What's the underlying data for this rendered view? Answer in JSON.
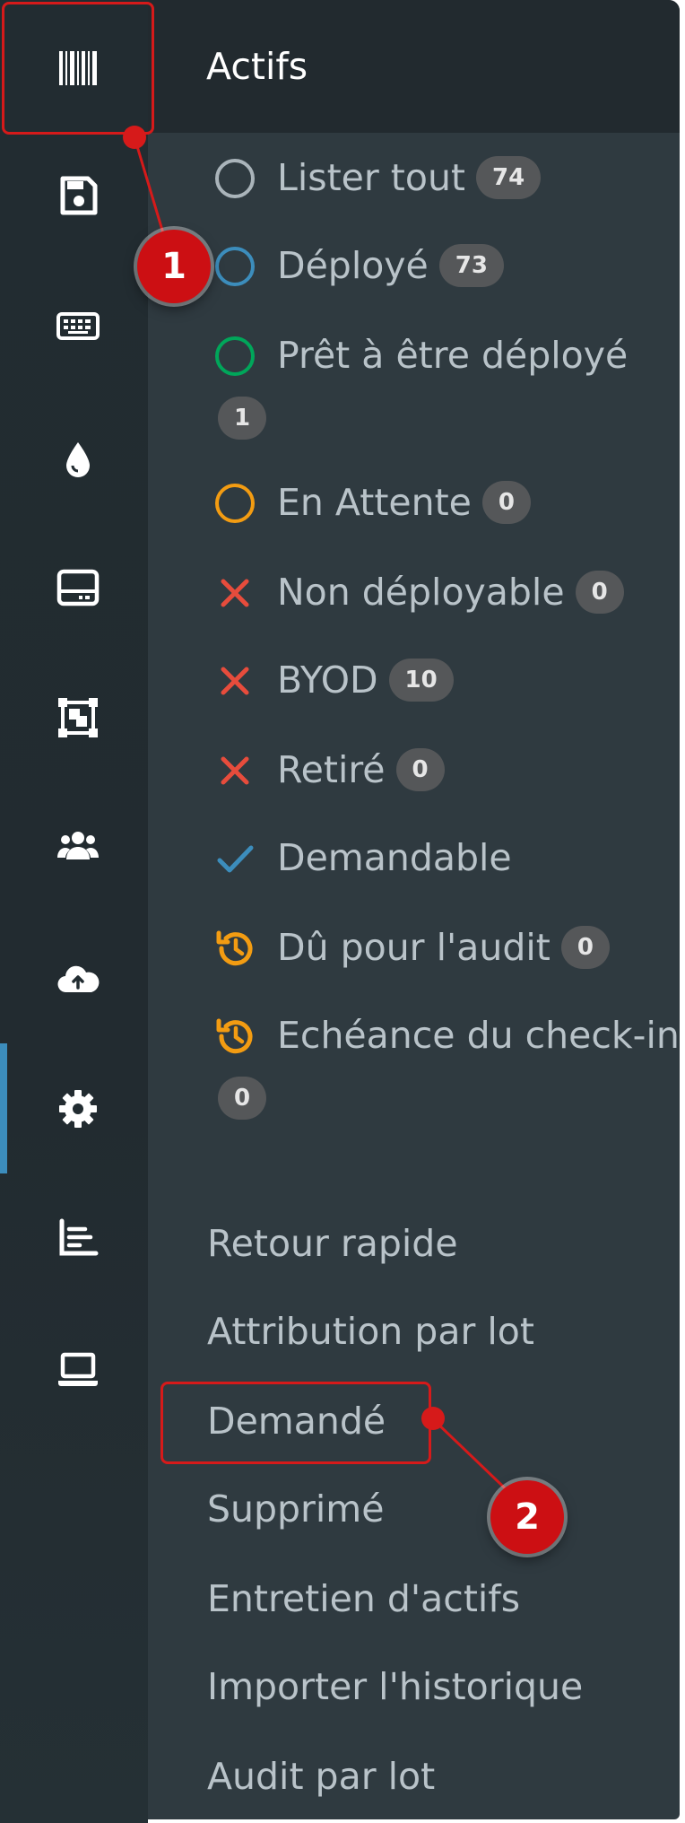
{
  "panel": {
    "title": "Actifs"
  },
  "status_items": [
    {
      "label": "Lister tout",
      "badge": "74",
      "icon": "circle-outline-icon",
      "color": "#aab4ba"
    },
    {
      "label": "Déployé",
      "badge": "73",
      "icon": "circle-outline-icon",
      "color": "#3c8dbc"
    },
    {
      "label": "Prêt à être déployé",
      "badge": "1",
      "icon": "circle-outline-icon",
      "color": "#00a65a"
    },
    {
      "label": "En Attente",
      "badge": "0",
      "icon": "circle-outline-icon",
      "color": "#f39c12"
    },
    {
      "label": "Non déployable",
      "badge": "0",
      "icon": "x-icon",
      "color": "#e74c3c"
    },
    {
      "label": "BYOD",
      "badge": "10",
      "icon": "x-icon",
      "color": "#e74c3c"
    },
    {
      "label": "Retiré",
      "badge": "0",
      "icon": "x-icon",
      "color": "#e74c3c"
    },
    {
      "label": "Demandable",
      "badge": "",
      "icon": "check-icon",
      "color": "#3c8dbc"
    },
    {
      "label": "Dû pour l'audit",
      "badge": "0",
      "icon": "history-icon",
      "color": "#f39c12"
    },
    {
      "label": "Echéance du check-in",
      "badge": "0",
      "icon": "history-icon",
      "color": "#f39c12"
    }
  ],
  "links": [
    {
      "label": "Retour rapide"
    },
    {
      "label": "Attribution par lot"
    },
    {
      "label": "Demandé"
    },
    {
      "label": "Supprimé"
    },
    {
      "label": "Entretien d'actifs"
    },
    {
      "label": "Importer l'historique"
    },
    {
      "label": "Audit par lot"
    }
  ],
  "rail_icons": [
    "barcode-icon",
    "floppy-disk-icon",
    "keyboard-icon",
    "droplet-icon",
    "hard-drive-icon",
    "object-group-icon",
    "users-icon",
    "cloud-upload-icon",
    "gear-icon",
    "chart-area-icon",
    "laptop-icon"
  ],
  "callouts": {
    "one": "1",
    "two": "2"
  },
  "colors": {
    "highlight": "#d61a1a",
    "active": "#3c8dbc"
  }
}
